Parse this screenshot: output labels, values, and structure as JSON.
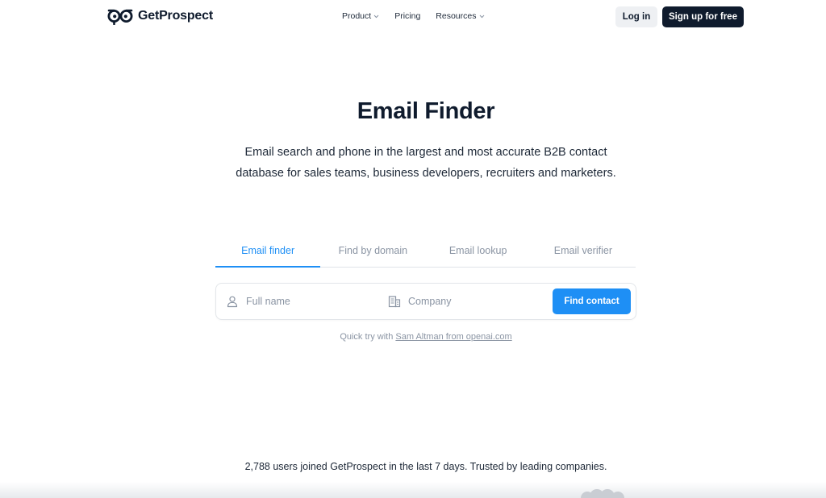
{
  "brand": {
    "name": "GetProspect"
  },
  "nav": {
    "items": [
      {
        "label": "Product",
        "has_dropdown": true
      },
      {
        "label": "Pricing",
        "has_dropdown": false
      },
      {
        "label": "Resources",
        "has_dropdown": true
      }
    ]
  },
  "header": {
    "login_label": "Log in",
    "signup_label": "Sign up for free"
  },
  "hero": {
    "title": "Email Finder",
    "subtitle": "Email search and phone in the largest and most accurate B2B contact database for sales teams, business developers, recruiters and marketers."
  },
  "tabs": [
    {
      "label": "Email finder",
      "active": true
    },
    {
      "label": "Find by domain",
      "active": false
    },
    {
      "label": "Email lookup",
      "active": false
    },
    {
      "label": "Email verifier",
      "active": false
    }
  ],
  "search": {
    "name_placeholder": "Full name",
    "company_placeholder": "Company",
    "button_label": "Find contact"
  },
  "quick_try": {
    "prefix": "Quick try with",
    "link_text": "Sam Altman from openai.com"
  },
  "trusted_text": "2,788 users joined GetProspect in the last 7 days. Trusted by leading companies.",
  "colors": {
    "accent": "#1e8ff5",
    "dark": "#0f1b2d",
    "muted": "#8a94a3"
  },
  "icons": {
    "name_field": "user-icon",
    "company_field": "building-icon",
    "dropdown": "chevron-down-icon"
  }
}
